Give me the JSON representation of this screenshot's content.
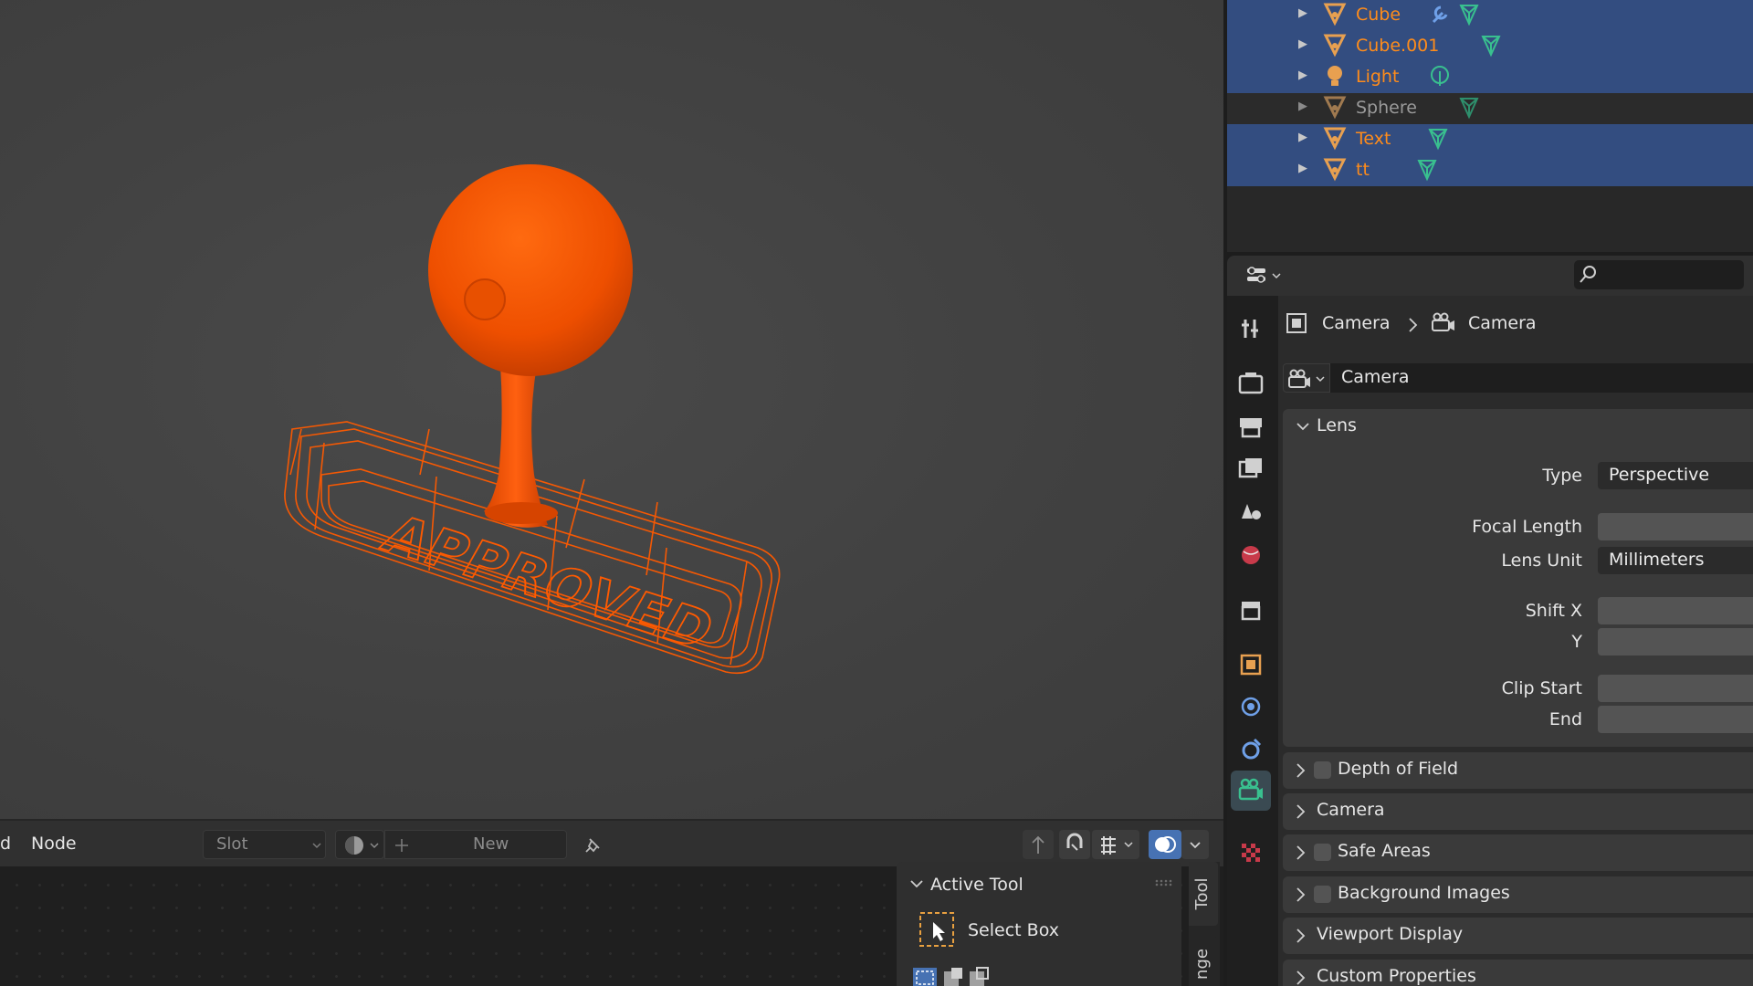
{
  "outliner": {
    "items": [
      {
        "name": "Cube",
        "selected": true
      },
      {
        "name": "Cube.001",
        "selected": true
      },
      {
        "name": "Light",
        "selected": true
      },
      {
        "name": "Sphere",
        "selected": false
      },
      {
        "name": "Text",
        "selected": true
      },
      {
        "name": "tt",
        "selected": true
      }
    ]
  },
  "viewport": {
    "stamp_text": "APPROVED",
    "object_color": "#ff5a00"
  },
  "shader_header": {
    "left_partial": "d",
    "node_menu": "Node",
    "slot_select": "Slot",
    "new_button": "New"
  },
  "tool_panel": {
    "title": "Active Tool",
    "tool_name": "Select Box",
    "tab_tool": "Tool",
    "tab_partial": "nge"
  },
  "properties": {
    "breadcrumb": {
      "object": "Camera",
      "data": "Camera"
    },
    "datablock_name": "Camera",
    "lens": {
      "title": "Lens",
      "type_label": "Type",
      "type_value": "Perspective",
      "focal_length_label": "Focal Length",
      "lens_unit_label": "Lens Unit",
      "lens_unit_value": "Millimeters",
      "shift_x_label": "Shift X",
      "shift_y_label": "Y",
      "clip_start_label": "Clip Start",
      "clip_end_label": "End"
    },
    "panels": {
      "dof": "Depth of Field",
      "camera": "Camera",
      "safe_areas": "Safe Areas",
      "background_images": "Background Images",
      "viewport_display": "Viewport Display",
      "custom_properties": "Custom Properties"
    }
  },
  "colors": {
    "selected_row": "#334d80",
    "selected_text": "#ff8c1a",
    "active_tab": "#3a4a52",
    "mesh_icon": "#e8a050",
    "data_icon_green": "#39c08f"
  }
}
